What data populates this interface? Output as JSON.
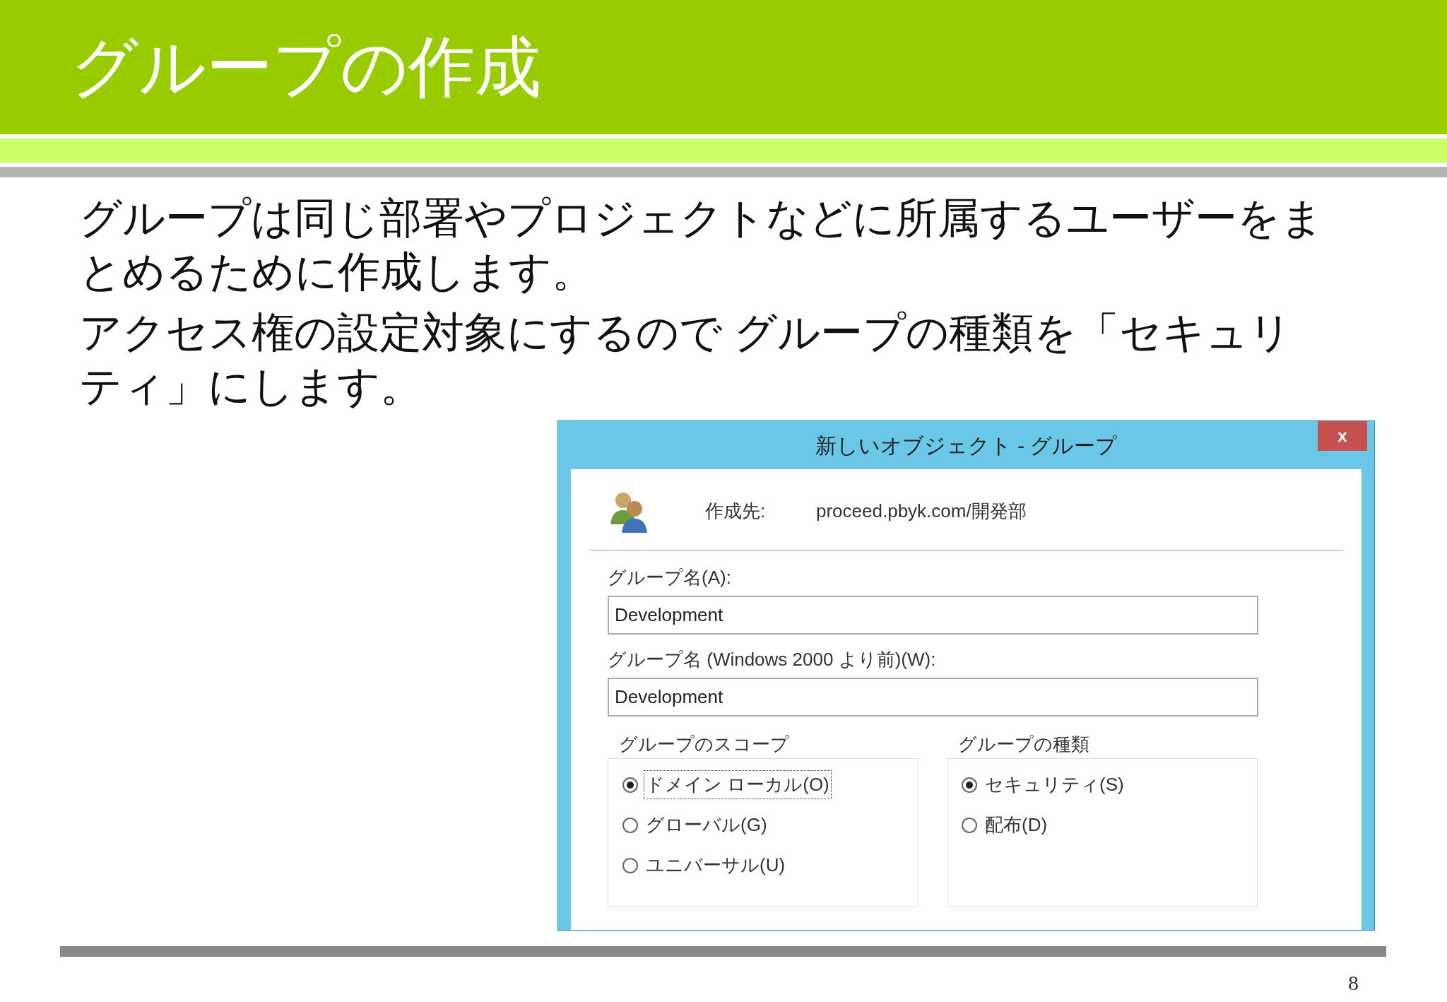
{
  "slide": {
    "title": "グループの作成",
    "paragraphs": [
      "グループは同じ部署やプロジェクトなどに所属するユーザーをまとめるために作成します。",
      "アクセス権の設定対象にするので グループの種類を「セキュリティ」にします。"
    ],
    "page_number": "8"
  },
  "dialog": {
    "title": "新しいオブジェクト - グループ",
    "close": "x",
    "create_in_label": "作成先:",
    "create_in_path": "proceed.pbyk.com/開発部",
    "fields": [
      {
        "label": "グループ名(A):",
        "value": "Development"
      },
      {
        "label": "グループ名 (Windows 2000 より前)(W):",
        "value": "Development"
      }
    ],
    "groups": [
      {
        "title": "グループのスコープ",
        "options": [
          {
            "label": "ドメイン ローカル(O)",
            "selected": true,
            "focused": true
          },
          {
            "label": "グローバル(G)",
            "selected": false,
            "focused": false
          },
          {
            "label": "ユニバーサル(U)",
            "selected": false,
            "focused": false
          }
        ]
      },
      {
        "title": "グループの種類",
        "options": [
          {
            "label": "セキュリティ(S)",
            "selected": true,
            "focused": false
          },
          {
            "label": "配布(D)",
            "selected": false,
            "focused": false
          }
        ]
      }
    ]
  }
}
